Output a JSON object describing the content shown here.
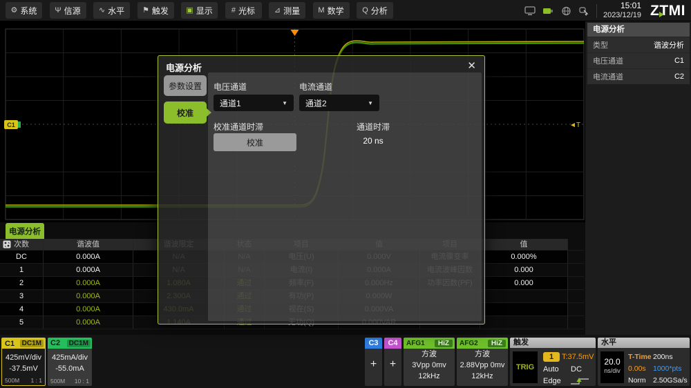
{
  "toolbar": {
    "buttons": [
      {
        "label": "系统",
        "icon": "⚙"
      },
      {
        "label": "信源",
        "icon": "Ψ"
      },
      {
        "label": "水平",
        "icon": "∿"
      },
      {
        "label": "触发",
        "icon": "⚑"
      },
      {
        "label": "显示",
        "icon": "▣"
      },
      {
        "label": "光标",
        "icon": "#"
      },
      {
        "label": "测量",
        "icon": "⊿"
      },
      {
        "label": "数学",
        "icon": "M"
      },
      {
        "label": "分析",
        "icon": "Q"
      }
    ],
    "clock": {
      "time": "15:01",
      "date": "2023/12/19"
    },
    "logo": "ZTMI"
  },
  "scope": {
    "channel_marker": "C1",
    "trigger_level_marker": "◄T"
  },
  "info_panel": {
    "title": "电源分析",
    "rows": [
      {
        "label": "类型",
        "value": "谐波分析"
      },
      {
        "label": "电压通道",
        "value": "C1"
      },
      {
        "label": "电流通道",
        "value": "C2"
      }
    ]
  },
  "dialog": {
    "title": "电源分析",
    "close": "✕",
    "tabs": [
      {
        "label": "参数设置"
      },
      {
        "label": "校准"
      }
    ],
    "voltage_label": "电压通道",
    "voltage_value": "通道1",
    "current_label": "电流通道",
    "current_value": "通道2",
    "dropdown_arrow": "▼",
    "deskew_cal_label": "校准通道时滞",
    "calibrate_button": "校准",
    "deskew_label": "通道时滞",
    "deskew_value": "20 ns"
  },
  "results": {
    "tab": "电源分析",
    "headers": [
      "次数",
      "谐波值",
      "谐波限定",
      "状态",
      "项目",
      "值",
      "项目",
      "值"
    ],
    "rows": [
      [
        "DC",
        "0.000A",
        "N/A",
        "N/A",
        "电压(U)",
        "0.000V",
        "电流骤变率",
        "0.000%"
      ],
      [
        "1",
        "0.000A",
        "N/A",
        "N/A",
        "电流(I)",
        "0.000A",
        "电流波峰因数",
        "0.000"
      ],
      [
        "2",
        "0.000A",
        "1.080A",
        "通过",
        "频率(F)",
        "0.000Hz",
        "功率因数(PF)",
        "0.000"
      ],
      [
        "3",
        "0.000A",
        "2.300A",
        "通过",
        "有功(P)",
        "0.000W",
        "",
        ""
      ],
      [
        "4",
        "0.000A",
        "430.0mA",
        "通过",
        "视在(S)",
        "0.000VA",
        "",
        ""
      ],
      [
        "5",
        "0.000A",
        "1.140A",
        "通过",
        "无功(Q)",
        "0.000VAR",
        "",
        ""
      ]
    ]
  },
  "channels": {
    "c1": {
      "name": "C1",
      "coupling": "DC1M",
      "scale": "425mV/div",
      "offset": "-37.5mV",
      "bw": "500M",
      "ratio": "1 : 1"
    },
    "c2": {
      "name": "C2",
      "coupling": "DC1M",
      "scale": "425mA/div",
      "offset": "-55.0mA",
      "bw": "500M",
      "ratio": "10 : 1"
    },
    "c3": {
      "name": "C3",
      "add": "+"
    },
    "c4": {
      "name": "C4",
      "add": "+"
    },
    "afg1": {
      "name": "AFG1",
      "impedance": "HiZ",
      "wave": "方波",
      "amplitude": "3Vpp  0mv",
      "freq": "12kHz"
    },
    "afg2": {
      "name": "AFG2",
      "impedance": "HiZ",
      "wave": "方波",
      "amplitude": "2.88Vpp  0mv",
      "freq": "12kHz"
    }
  },
  "trigger": {
    "title": "触发",
    "trig": "TRIG",
    "source": "1",
    "level": "T:37.5mV",
    "mode": "Auto",
    "coupling": "DC",
    "type": "Edge"
  },
  "horizontal": {
    "title": "水平",
    "scale": "20.0",
    "scale_unit": "ns/div",
    "t_time_label": "T-Time",
    "t_time_value": "200ns",
    "delay": "0.00s",
    "points": "1000*pts",
    "acq_mode": "Norm",
    "sample_rate": "2.50GSa/s"
  },
  "colors": {
    "accent_green": "#8cbe2c",
    "c1_yellow": "#d9c419",
    "c2_green": "#26bd5c",
    "c3_blue": "#2e7de0",
    "c4_magenta": "#c553cf",
    "afg_green": "#6fc02b",
    "trigger_orange": "#ff9d00",
    "points_blue": "#3aa0ff",
    "trace_yellow": "#c8b400",
    "trace_green": "#46a000"
  }
}
